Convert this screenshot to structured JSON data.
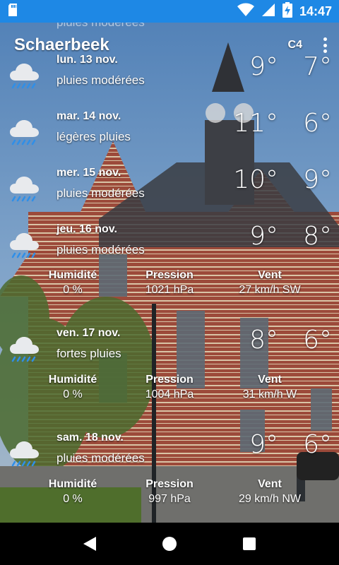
{
  "status_bar": {
    "time": "14:47",
    "icons": [
      "sd-card-icon",
      "wifi-icon",
      "cell-signal-icon",
      "battery-charging-icon"
    ]
  },
  "app_bar": {
    "title": "Schaerbeek",
    "code": "C4",
    "menu_icon": "more-vert-icon"
  },
  "top_partial_text": "pluies modérées",
  "forecast": [
    {
      "date": "lun. 13 nov.",
      "description": "pluies modérées",
      "max": "9°",
      "min": "7°",
      "icon": "rain-cloud-icon"
    },
    {
      "date": "mar. 14 nov.",
      "description": "légères pluies",
      "max": "11°",
      "min": "6°",
      "icon": "rain-cloud-icon"
    },
    {
      "date": "mer. 15 nov.",
      "description": "pluies modérées",
      "max": "10°",
      "min": "9°",
      "icon": "rain-cloud-icon"
    },
    {
      "date": "jeu. 16 nov.",
      "description": "pluies modérées",
      "max": "9°",
      "min": "8°",
      "icon": "rain-cloud-icon",
      "details": {
        "humidity_label": "Humidité",
        "humidity": "0 %",
        "pressure_label": "Pression",
        "pressure": "1021 hPa",
        "wind_label": "Vent",
        "wind": "27 km/h SW"
      }
    },
    {
      "date": "ven. 17 nov.",
      "description": "fortes pluies",
      "max": "8°",
      "min": "6°",
      "icon": "rain-cloud-icon",
      "details": {
        "humidity_label": "Humidité",
        "humidity": "0 %",
        "pressure_label": "Pression",
        "pressure": "1004 hPa",
        "wind_label": "Vent",
        "wind": "31 km/h W"
      }
    },
    {
      "date": "sam. 18 nov.",
      "description": "pluies modérées",
      "max": "9°",
      "min": "6°",
      "icon": "rain-cloud-icon",
      "details": {
        "humidity_label": "Humidité",
        "humidity": "0 %",
        "pressure_label": "Pression",
        "pressure": "997 hPa",
        "wind_label": "Vent",
        "wind": "29 km/h NW"
      }
    }
  ],
  "nav_bar": {
    "back_icon": "back-triangle-icon",
    "home_icon": "home-circle-icon",
    "recents_icon": "recents-square-icon"
  },
  "colors": {
    "status_bar": "#1e88e5",
    "nav_bar": "#000000",
    "rain_drops": "#2f8fe8",
    "cloud": "#e8eaed"
  }
}
